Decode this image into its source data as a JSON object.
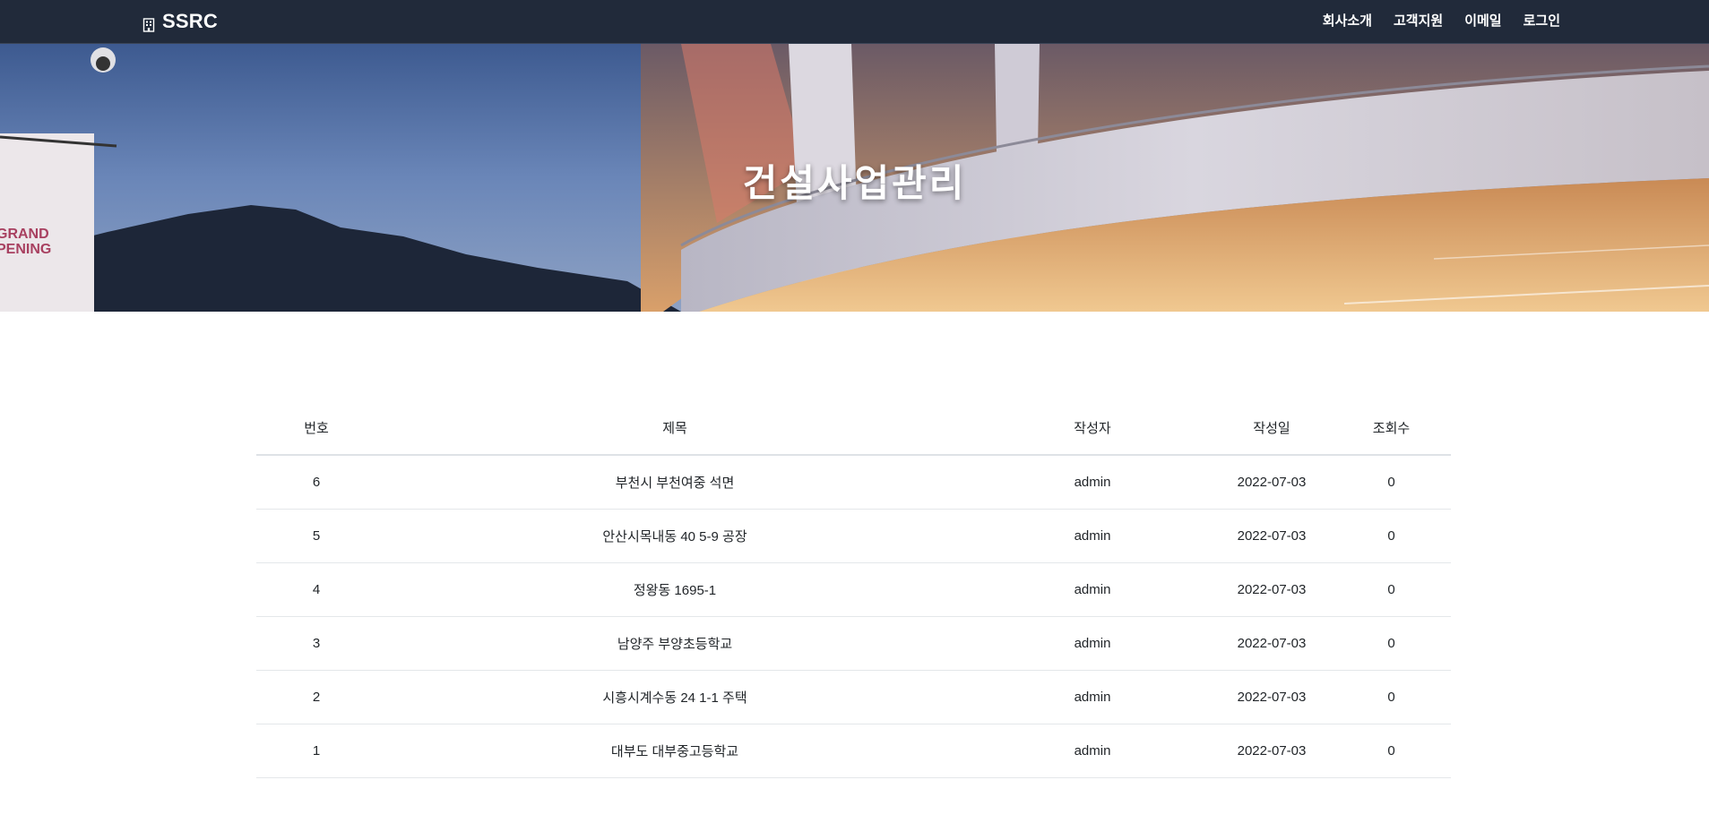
{
  "navbar": {
    "brand_icon": "building-icon",
    "brand": "SSRC",
    "links": [
      {
        "label": "회사소개"
      },
      {
        "label": "고객지원"
      },
      {
        "label": "이메일"
      },
      {
        "label": "로그인"
      }
    ],
    "bg_color": "#212a3a"
  },
  "hero": {
    "title": "건설사업관리"
  },
  "board": {
    "headers": {
      "num": "번호",
      "title": "제목",
      "author": "작성자",
      "date": "작성일",
      "views": "조회수"
    },
    "rows": [
      {
        "num": "6",
        "title": "부천시 부천여중 석면",
        "author": "admin",
        "date": "2022-07-03",
        "views": "0"
      },
      {
        "num": "5",
        "title": "안산시목내동 40 5-9 공장",
        "author": "admin",
        "date": "2022-07-03",
        "views": "0"
      },
      {
        "num": "4",
        "title": "정왕동 1695-1",
        "author": "admin",
        "date": "2022-07-03",
        "views": "0"
      },
      {
        "num": "3",
        "title": "남양주 부양초등학교",
        "author": "admin",
        "date": "2022-07-03",
        "views": "0"
      },
      {
        "num": "2",
        "title": "시흥시계수동 24 1-1 주택",
        "author": "admin",
        "date": "2022-07-03",
        "views": "0"
      },
      {
        "num": "1",
        "title": "대부도 대부중고등학교",
        "author": "admin",
        "date": "2022-07-03",
        "views": "0"
      }
    ]
  }
}
